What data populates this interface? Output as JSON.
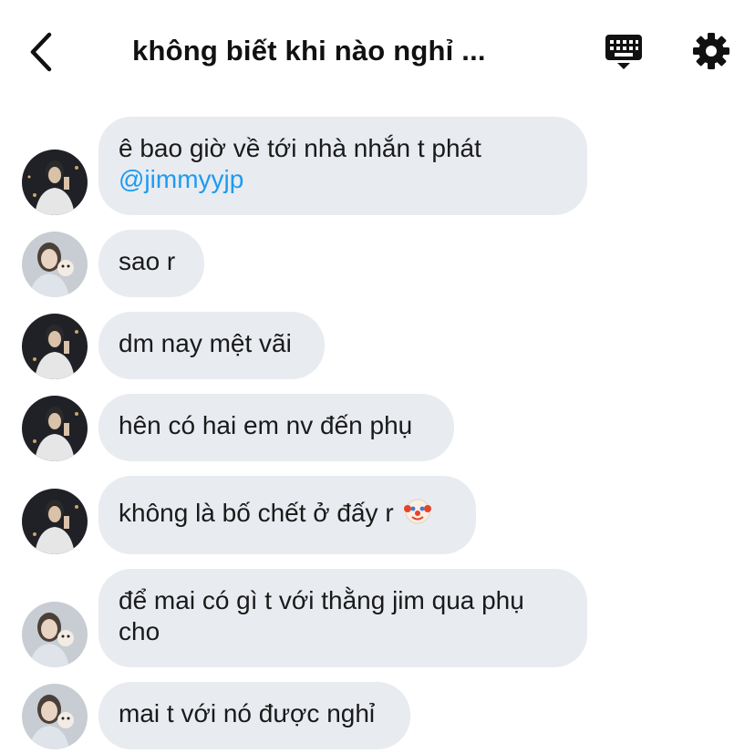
{
  "header": {
    "title": "không biết khi nào nghỉ ...",
    "back_icon": "chevron-left-icon",
    "keyboard_icon": "keyboard-icon",
    "settings_icon": "gear-icon"
  },
  "messages": [
    {
      "sender": "jimmy",
      "text": "ê bao giờ về tới nhà nhắn t phát",
      "mention": "@jimmyyjp"
    },
    {
      "sender": "girl",
      "text": "sao r"
    },
    {
      "sender": "jimmy",
      "text": "dm nay mệt vãi"
    },
    {
      "sender": "jimmy",
      "text": "hên có hai em nv đến phụ"
    },
    {
      "sender": "jimmy",
      "text": "không là bố chết ở đấy r",
      "emoji": "clown-face-icon"
    },
    {
      "sender": "girl",
      "text": "để mai có gì t với thằng jim qua phụ cho"
    },
    {
      "sender": "girl",
      "text": "mai t với nó được nghỉ"
    }
  ],
  "colors": {
    "bubble": "#e8ebf0",
    "mention": "#1d9bf0",
    "text": "#1a1a1a"
  }
}
